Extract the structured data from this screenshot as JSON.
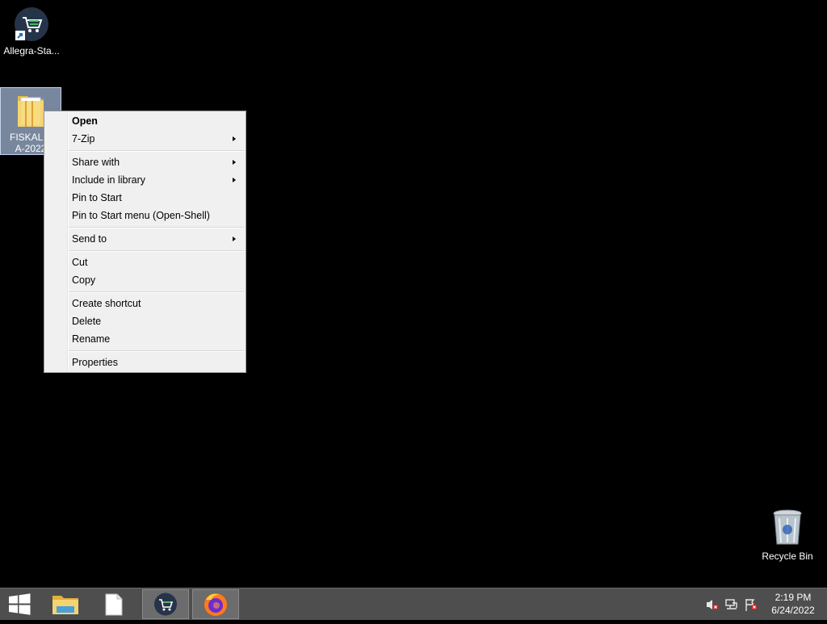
{
  "desktop": {
    "icons": [
      {
        "label": "Allegra-Sta..."
      },
      {
        "label": "FISKALIZACIJA-2022",
        "label_line1": "FISKALIZ",
        "label_line2": "A-2022"
      },
      {
        "label": "Recycle Bin"
      }
    ]
  },
  "context_menu": {
    "items": [
      {
        "label": "Open",
        "bold": true
      },
      {
        "label": "7-Zip",
        "submenu": true
      },
      {
        "label": "Share with",
        "submenu": true
      },
      {
        "label": "Include in library",
        "submenu": true
      },
      {
        "label": "Pin to Start"
      },
      {
        "label": "Pin to Start menu (Open-Shell)"
      },
      {
        "label": "Send to",
        "submenu": true
      },
      {
        "label": "Cut"
      },
      {
        "label": "Copy"
      },
      {
        "label": "Create shortcut"
      },
      {
        "label": "Delete"
      },
      {
        "label": "Rename"
      },
      {
        "label": "Properties"
      }
    ]
  },
  "taskbar": {
    "buttons": [
      "windows-start",
      "file-explorer",
      "blank-document",
      "allegra-store",
      "firefox"
    ],
    "tray_icons": [
      "volume-muted-icon",
      "network-icon",
      "action-center-flag-icon"
    ],
    "clock": {
      "time": "2:19 PM",
      "date": "6/24/2022"
    }
  },
  "colors": {
    "desktop_bg": "#000000",
    "taskbar_bg": "#4e4e4e",
    "menu_bg": "#f0f0f0"
  }
}
